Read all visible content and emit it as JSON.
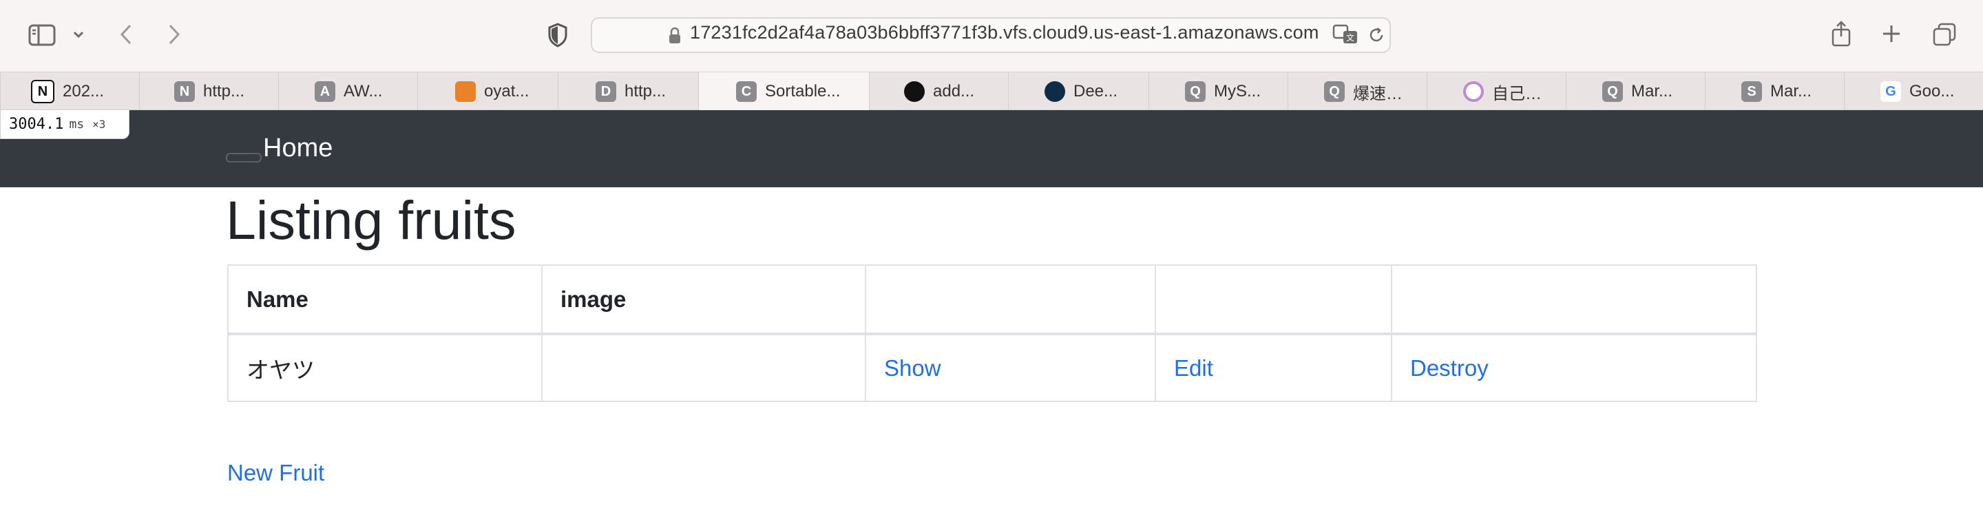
{
  "browser": {
    "url": "17231fc2d2af4a78a03b6bbff3771f3b.vfs.cloud9.us-east-1.amazonaws.com",
    "tabs": [
      {
        "label": "202...",
        "favicon": "N",
        "color": "#111111"
      },
      {
        "label": "http...",
        "favicon": "N",
        "color": "#8a8a8f"
      },
      {
        "label": "AW...",
        "favicon": "A",
        "color": "#8a8a8f"
      },
      {
        "label": "oyat...",
        "favicon": "",
        "color": "#e8832a"
      },
      {
        "label": "http...",
        "favicon": "D",
        "color": "#8a8a8f"
      },
      {
        "label": "Sortable...",
        "favicon": "C",
        "color": "#8a8a8f",
        "active": true
      },
      {
        "label": "add...",
        "favicon": "",
        "color": "#111111"
      },
      {
        "label": "Dee...",
        "favicon": "",
        "color": "#0f2b46"
      },
      {
        "label": "MyS...",
        "favicon": "Q",
        "color": "#8a8a8f"
      },
      {
        "label": "爆速…",
        "favicon": "Q",
        "color": "#8a8a8f"
      },
      {
        "label": "自己…",
        "favicon": "",
        "color": "#b98cd8"
      },
      {
        "label": "Mar...",
        "favicon": "Q",
        "color": "#8a8a8f"
      },
      {
        "label": "Mar...",
        "favicon": "S",
        "color": "#8a8a8f"
      },
      {
        "label": "Goo...",
        "favicon": "G",
        "color": "#4285f4"
      }
    ]
  },
  "perf": {
    "value": "3004.1",
    "unit": "ms",
    "multiplier": "×3"
  },
  "navbar": {
    "brand": "Home"
  },
  "page": {
    "title": "Listing fruits",
    "table": {
      "headers": [
        "Name",
        "image",
        "",
        "",
        ""
      ],
      "rows": [
        {
          "name": "オヤツ",
          "image": "",
          "show": "Show",
          "edit": "Edit",
          "destroy": "Destroy"
        }
      ]
    },
    "new_link": "New Fruit"
  }
}
